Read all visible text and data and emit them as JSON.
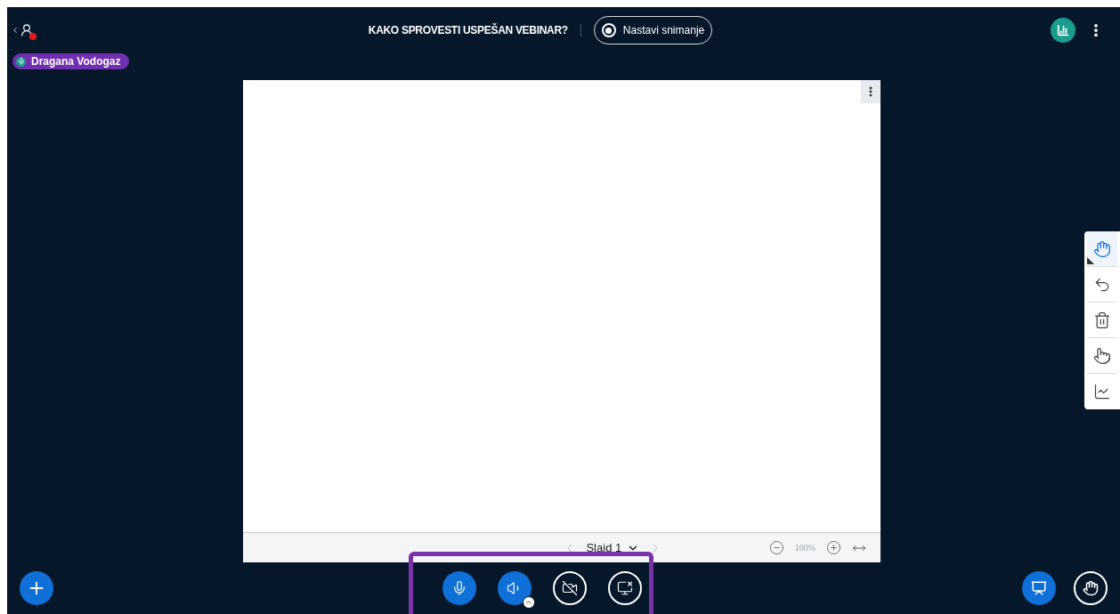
{
  "header": {
    "title": "KAKO SPROVESTI USPEŠAN VEBINAR?",
    "record_button": "Nastavi snimanje"
  },
  "presenter": {
    "name": "Dragana Vodogaz"
  },
  "slide_footer": {
    "slide_label": "Slaid 1",
    "zoom": "100%"
  },
  "tools": [
    {
      "kind": "hand",
      "selected": true
    },
    {
      "kind": "undo",
      "selected": false
    },
    {
      "kind": "trash",
      "selected": false
    },
    {
      "kind": "multi",
      "selected": false
    },
    {
      "kind": "whiteboard",
      "selected": false
    }
  ],
  "controls": [
    {
      "kind": "mic",
      "active": true
    },
    {
      "kind": "audio",
      "active": true
    },
    {
      "kind": "camera",
      "active": false
    },
    {
      "kind": "screen",
      "active": false
    }
  ]
}
